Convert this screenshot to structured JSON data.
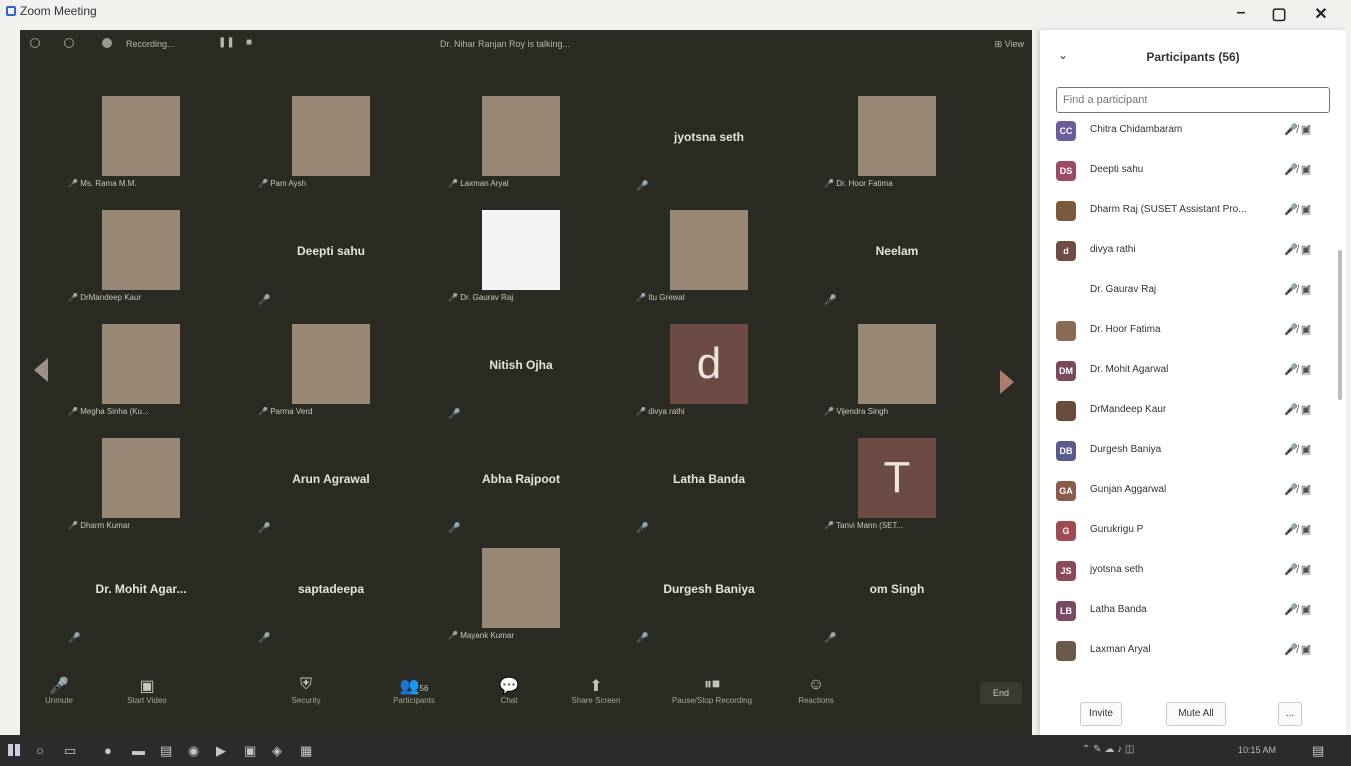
{
  "window": {
    "title": "Zoom Meeting",
    "minimize": "–",
    "maximize": "▢",
    "close": "✕"
  },
  "top_bar": {
    "recording": "Recording...",
    "talking": "Dr. Nihar Ranjan Roy is talking...",
    "view": "View"
  },
  "tiles": [
    {
      "name": "Ms. Rama M.M.",
      "kind": "photo"
    },
    {
      "name": "Pam Aysh",
      "kind": "photo"
    },
    {
      "name": "Laxman Aryal",
      "kind": "photo"
    },
    {
      "name": "jyotsna seth",
      "kind": "name"
    },
    {
      "name": "Dr. Hoor Fatima",
      "kind": "photo"
    },
    {
      "name": "DrMandeep Kaur",
      "kind": "photo"
    },
    {
      "name": "Deepti sahu",
      "kind": "name"
    },
    {
      "name": "Dr. Gaurav Raj",
      "kind": "blank"
    },
    {
      "name": "Itu Grewal",
      "kind": "photo"
    },
    {
      "name": "Neelam",
      "kind": "name"
    },
    {
      "name": "Megha Sinha (Ku...",
      "kind": "photo"
    },
    {
      "name": "Parma Verd",
      "kind": "photo"
    },
    {
      "name": "Nitish Ojha",
      "kind": "name"
    },
    {
      "name": "divya rathi",
      "kind": "letter",
      "letter": "d"
    },
    {
      "name": "Vijendra Singh",
      "kind": "photo"
    },
    {
      "name": "Dharm Kumar",
      "kind": "photo"
    },
    {
      "name": "Arun Agrawal",
      "kind": "name"
    },
    {
      "name": "Abha Rajpoot",
      "kind": "name"
    },
    {
      "name": "Latha Banda",
      "kind": "name"
    },
    {
      "name": "Tanvi Mann (SET...",
      "kind": "letter",
      "letter": "T"
    },
    {
      "name": "Dr. Mohit Agar...",
      "kind": "name"
    },
    {
      "name": "saptadeepa",
      "kind": "name"
    },
    {
      "name": "Mayank Kumar",
      "kind": "photo"
    },
    {
      "name": "Durgesh Baniya",
      "kind": "name"
    },
    {
      "name": "om Singh",
      "kind": "name"
    }
  ],
  "toolbar": {
    "unmute": "Unmute",
    "start_video": "Start Video",
    "security": "Security",
    "participants": "Participants",
    "participants_count": "56",
    "chat": "Chat",
    "share_screen": "Share Screen",
    "recording": "Pause/Stop Recording",
    "reactions": "Reactions",
    "end": "End"
  },
  "panel": {
    "title": "Participants (56)",
    "search_placeholder": "Find a participant",
    "participants": [
      {
        "initials": "CC",
        "name": "Chitra Chidambaram",
        "color": "#6b5c9c"
      },
      {
        "initials": "DS",
        "name": "Deepti sahu",
        "color": "#9c4a64"
      },
      {
        "initials": "",
        "name": "Dharm Raj (SUSET Assistant Pro...",
        "color": "#7a5a3a"
      },
      {
        "initials": "d",
        "name": "divya rathi",
        "color": "#6e4c44"
      },
      {
        "initials": "",
        "name": "Dr. Gaurav Raj",
        "color": "#ffffff"
      },
      {
        "initials": "",
        "name": "Dr. Hoor Fatima",
        "color": "#8a6a52"
      },
      {
        "initials": "DM",
        "name": "Dr. Mohit Agarwal",
        "color": "#7a4a5c"
      },
      {
        "initials": "",
        "name": "DrMandeep Kaur",
        "color": "#6a4a3a"
      },
      {
        "initials": "DB",
        "name": "Durgesh Baniya",
        "color": "#5a5a8c"
      },
      {
        "initials": "GA",
        "name": "Gunjan Aggarwal",
        "color": "#8a5a4a"
      },
      {
        "initials": "G",
        "name": "Gurukrigu P",
        "color": "#a04a52"
      },
      {
        "initials": "JS",
        "name": "jyotsna seth",
        "color": "#8c4a58"
      },
      {
        "initials": "LB",
        "name": "Latha Banda",
        "color": "#7a4a64"
      },
      {
        "initials": "",
        "name": "Laxman Aryal",
        "color": "#6a5a4a"
      }
    ],
    "invite": "Invite",
    "mute_all": "Mute All",
    "more": "..."
  },
  "taskbar": {
    "clock": "10:15 AM"
  }
}
